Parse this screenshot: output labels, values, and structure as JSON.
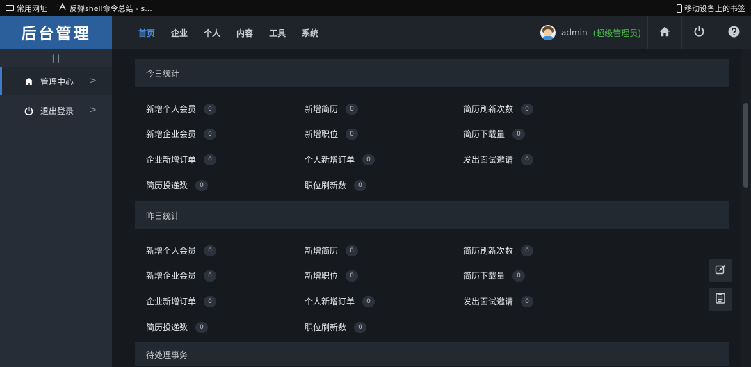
{
  "bookmarks": {
    "item1": "常用网址",
    "item2": "反弹shell命令总结 - s...",
    "mobile": "移动设备上的书签"
  },
  "sidebar": {
    "logo": "后台管理",
    "toggle": "|||",
    "items": [
      {
        "label": "管理中心",
        "icon": "home-icon"
      },
      {
        "label": "退出登录",
        "icon": "power-icon"
      }
    ]
  },
  "nav": {
    "items": [
      "首页",
      "企业",
      "个人",
      "内容",
      "工具",
      "系统"
    ],
    "active": "首页"
  },
  "user": {
    "name": "admin",
    "role": "(超级管理员)"
  },
  "sections": {
    "today": {
      "title": "今日统计",
      "stats": [
        {
          "label": "新增个人会员",
          "value": "0"
        },
        {
          "label": "新增简历",
          "value": "0"
        },
        {
          "label": "简历刷新次数",
          "value": "0"
        },
        {
          "label": "新增企业会员",
          "value": "0"
        },
        {
          "label": "新增职位",
          "value": "0"
        },
        {
          "label": "简历下载量",
          "value": "0"
        },
        {
          "label": "企业新增订单",
          "value": "0"
        },
        {
          "label": "个人新增订单",
          "value": "0"
        },
        {
          "label": "发出面试邀请",
          "value": "0"
        },
        {
          "label": "简历投递数",
          "value": "0"
        },
        {
          "label": "职位刷新数",
          "value": "0"
        }
      ]
    },
    "yesterday": {
      "title": "昨日统计",
      "stats": [
        {
          "label": "新增个人会员",
          "value": "0"
        },
        {
          "label": "新增简历",
          "value": "0"
        },
        {
          "label": "简历刷新次数",
          "value": "0"
        },
        {
          "label": "新增企业会员",
          "value": "0"
        },
        {
          "label": "新增职位",
          "value": "0"
        },
        {
          "label": "简历下载量",
          "value": "0"
        },
        {
          "label": "企业新增订单",
          "value": "0"
        },
        {
          "label": "个人新增订单",
          "value": "0"
        },
        {
          "label": "发出面试邀请",
          "value": "0"
        },
        {
          "label": "简历投递数",
          "value": "0"
        },
        {
          "label": "职位刷新数",
          "value": "0"
        }
      ]
    },
    "pending": {
      "title": "待处理事务"
    }
  },
  "colors": {
    "accent": "#2a5f9c",
    "nav_active": "#4a8fd9",
    "role": "#4cbf4c"
  }
}
